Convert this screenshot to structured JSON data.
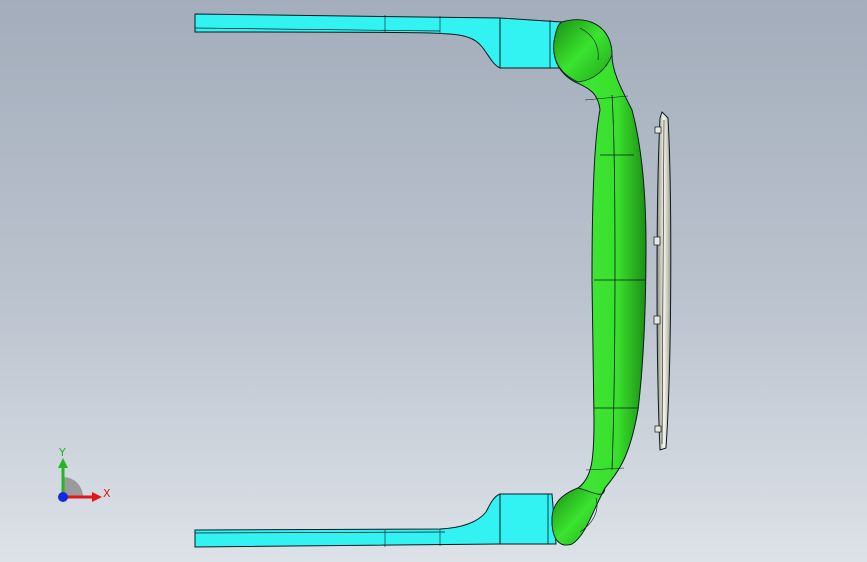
{
  "viewport": {
    "background_top": "#a3adbb",
    "background_bottom": "#dde2e8"
  },
  "model": {
    "temple_color": "#33f2f2",
    "frame_color": "#33e22a",
    "frame_dark": "#1fa018",
    "lens_color": "#f2f2e6",
    "edge_color": "#0b1b20"
  },
  "triad": {
    "x_label": "X",
    "y_label": "Y",
    "x_color": "#e01818",
    "y_color": "#25b525",
    "z_color": "#1428e0"
  }
}
